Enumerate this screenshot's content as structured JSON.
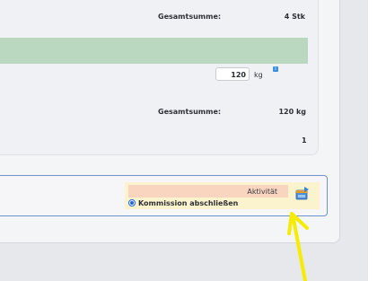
{
  "summary_top": {
    "label": "Gesamtsumme:",
    "value": "4 Stk"
  },
  "quantity": {
    "value": "120",
    "unit": "kg"
  },
  "summary_bottom": {
    "label": "Gesamtsumme:",
    "value": "120 kg"
  },
  "count": "1",
  "action": {
    "activity_label": "Aktivität",
    "radio_label": "Kommission abschließen",
    "radio_checked": true
  },
  "icons": {
    "info": "info-icon",
    "run": "run-activity-icon",
    "annotation": "arrow-annotation"
  },
  "colors": {
    "green_bar": "#bad8c0",
    "activity_bg": "#f9d5bf",
    "highlight": "#fbf3cd",
    "box_border": "#6e93c9",
    "arrow": "#f5ec00"
  }
}
